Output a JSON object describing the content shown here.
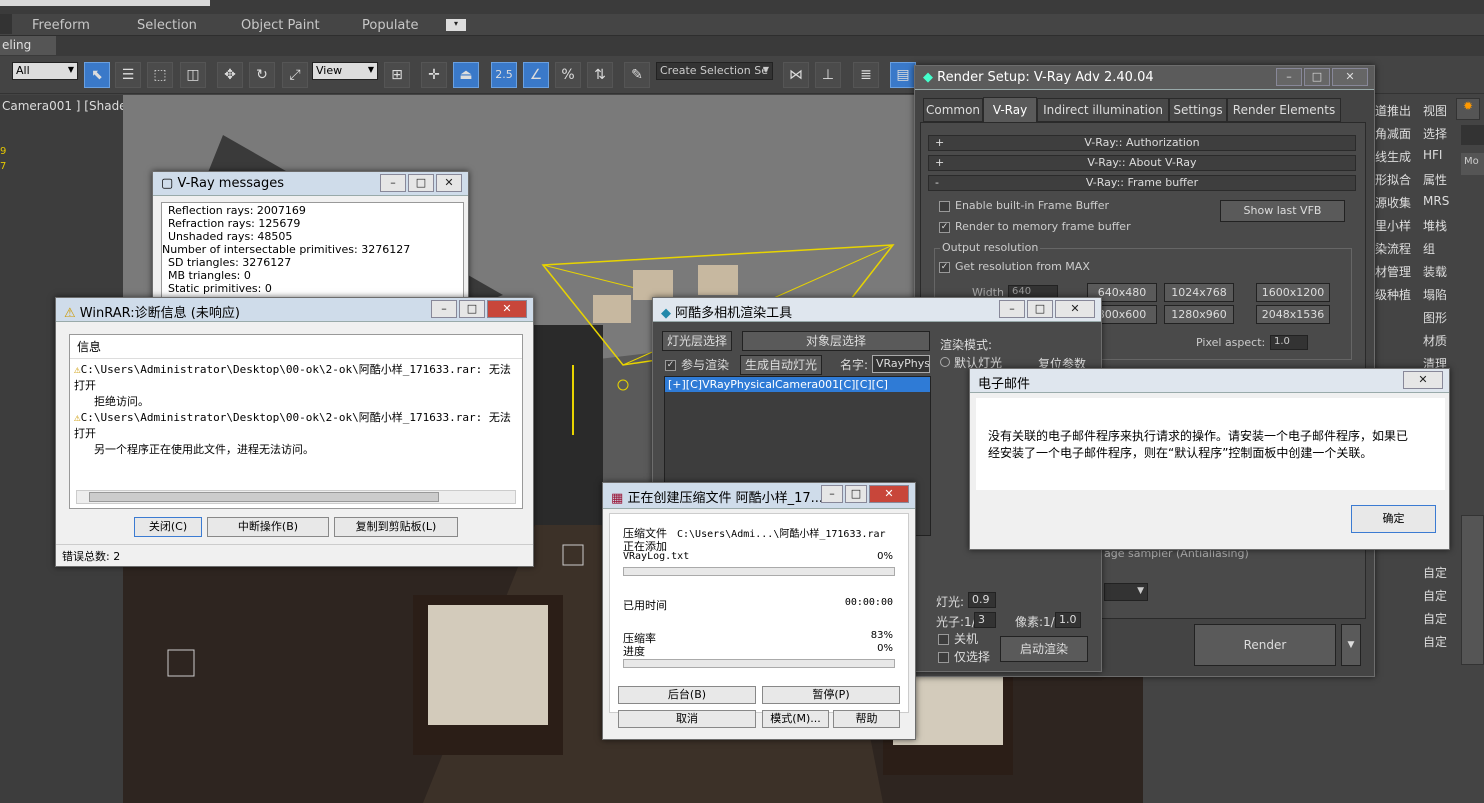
{
  "app": {
    "ribbon_tabs": [
      "Freeform",
      "Selection",
      "Object Paint",
      "Populate"
    ],
    "modeling_tab": "eling",
    "filter_dropdown": "All",
    "view_dropdown": "View",
    "snap_label": "2.5",
    "named_selection_placeholder": "Create Selection Se",
    "viewport_label": "Camera001 ] [Shaded]",
    "vp_stat1": "9",
    "vp_stat2": "7"
  },
  "right_panel": {
    "col1": [
      "道推出",
      "角减面",
      "线生成",
      "形拟合",
      "源收集",
      "里小样",
      "染流程",
      "材管理",
      "级种植"
    ],
    "col2": [
      "视图",
      "选择",
      "HFI",
      "属性",
      "MRS",
      "堆栈",
      "组",
      "装载",
      "塌陷",
      "图形",
      "材质",
      "清理"
    ],
    "custom": [
      "自定",
      "自定",
      "自定",
      "自定"
    ]
  },
  "vray_messages": {
    "title": "V-Ray messages",
    "lines": [
      "Reflection rays: 2007169",
      "Refraction rays: 125679",
      "Unshaded rays: 48505",
      "Number of intersectable primitives: 3276127",
      "SD triangles: 3276127",
      "MB triangles: 0",
      "Static primitives: 0"
    ]
  },
  "winrar_diag": {
    "title": "WinRAR:诊断信息 (未响应)",
    "header": "信息",
    "msg1_line1": "C:\\Users\\Administrator\\Desktop\\00-ok\\2-ok\\阿酷小样_171633.rar: 无法打开",
    "msg1_line2": "拒绝访问。",
    "msg2_line1": "C:\\Users\\Administrator\\Desktop\\00-ok\\2-ok\\阿酷小样_171633.rar: 无法打开",
    "msg2_line2": "另一个程序正在使用此文件，进程无法访问。",
    "btn_close": "关闭(C)",
    "btn_abort": "中断操作(B)",
    "btn_copy": "复制到剪贴板(L)",
    "error_total": "错误总数: 2"
  },
  "render_setup": {
    "title": "Render Setup: V-Ray Adv 2.40.04",
    "tabs": [
      "Common",
      "V-Ray",
      "Indirect illumination",
      "Settings",
      "Render Elements"
    ],
    "rollouts": [
      {
        "sign": "+",
        "label": "V-Ray:: Authorization"
      },
      {
        "sign": "+",
        "label": "V-Ray:: About V-Ray"
      },
      {
        "sign": "-",
        "label": "V-Ray:: Frame buffer"
      }
    ],
    "enable_vfb": "Enable built-in Frame Buffer",
    "show_last_vfb": "Show last VFB",
    "render_to_memory": "Render to memory frame buffer",
    "output_resolution": "Output resolution",
    "get_res_from_max": "Get resolution from MAX",
    "width_label": "Width",
    "width_value": "640",
    "res_buttons": [
      "640x480",
      "1024x768",
      "1600x1200",
      "800x600",
      "1280x960",
      "2048x1536"
    ],
    "pixel_aspect_label": "Pixel aspect:",
    "pixel_aspect_value": "1.0",
    "image_sampler": "age sampler (Antialiasing)",
    "render_btn": "Render"
  },
  "multicam": {
    "title": "阿酷多相机渲染工具",
    "light_layer": "灯光层选择",
    "object_layer": "对象层选择",
    "render_mode": "渲染模式:",
    "join_render": "参与渲染",
    "gen_auto_light": "生成自动灯光",
    "name_label": "名字:",
    "name_value": "VRayPhys",
    "default_light": "默认灯光",
    "reset_params": "复位参数",
    "camera_item": "[+][C]VRayPhysicalCamera001[C][C][C]",
    "light_label": "灯光:",
    "light_value": "0.9",
    "photon_label": "光子:1/",
    "photon_value": "3",
    "pixel_label": "像素:1/",
    "pixel_value": "1.0",
    "shutdown": "关机",
    "only_selected": "仅选择",
    "start_render": "启动渲染"
  },
  "email_dialog": {
    "title": "电子邮件",
    "line1": "没有关联的电子邮件程序来执行请求的操作。请安装一个电子邮件程序，如果已",
    "line2": "经安装了一个电子邮件程序，则在“默认程序”控制面板中创建一个关联。",
    "ok": "确定"
  },
  "compress": {
    "title": "正在创建压缩文件 阿酷小样_17...",
    "archive_label": "压缩文件",
    "archive_path": "C:\\Users\\Admi...\\阿酷小样_171633.rar",
    "adding": "正在添加",
    "file": "VRayLog.txt",
    "file_pct": "0%",
    "file_progress": 0,
    "elapsed_label": "已用时间",
    "elapsed": "00:00:00",
    "ratio_label": "压缩率",
    "ratio": "83%",
    "progress_label": "进度",
    "progress": "0%",
    "total_progress": 0,
    "btn_background": "后台(B)",
    "btn_pause": "暂停(P)",
    "btn_cancel": "取消",
    "btn_mode": "模式(M)...",
    "btn_help": "帮助"
  }
}
